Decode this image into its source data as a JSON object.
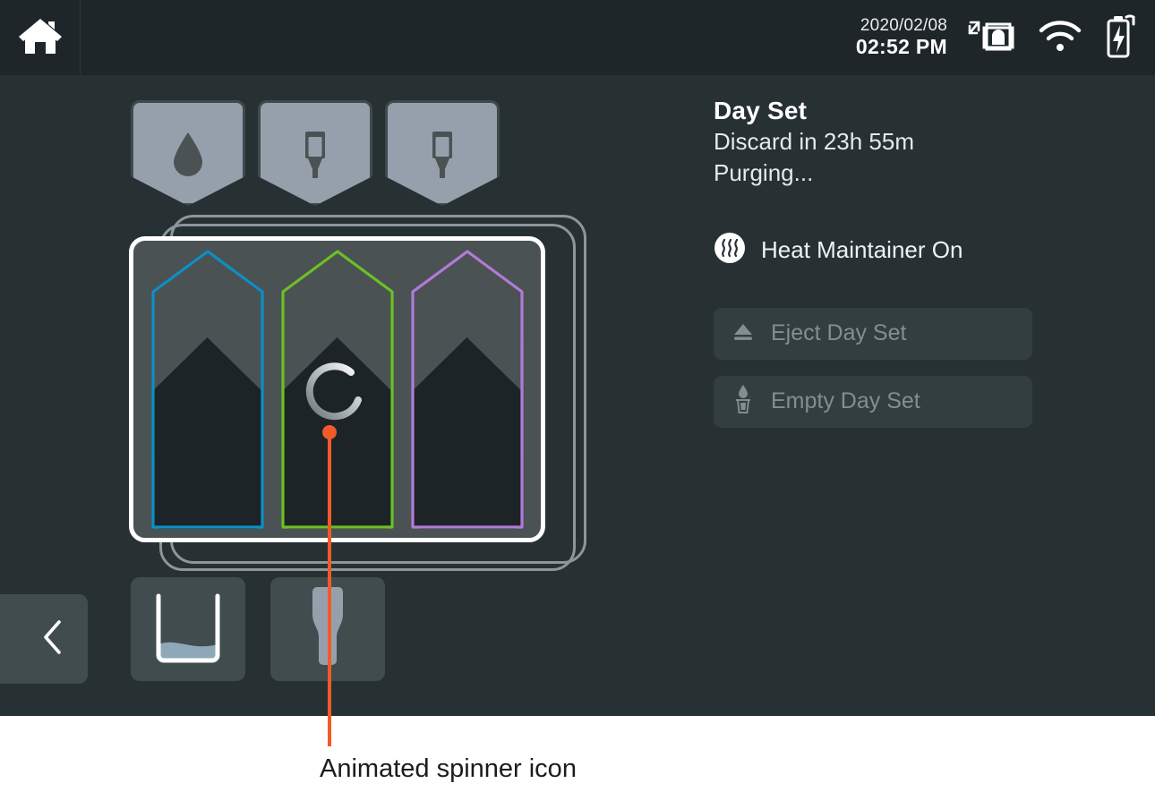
{
  "topbar": {
    "home_icon": "home-icon",
    "date": "2020/02/08",
    "time": "02:52 PM",
    "status_icons": [
      {
        "name": "transfer-printer-icon",
        "label": "Transfer"
      },
      {
        "name": "wifi-icon",
        "label": "Wi-Fi"
      },
      {
        "name": "battery-charging-icon",
        "label": "Battery charging"
      }
    ]
  },
  "nav": {
    "back_icon": "chevron-left-icon",
    "back_label": "Back"
  },
  "status_shields": [
    {
      "name": "shield-fluid",
      "icon": "droplet-icon"
    },
    {
      "name": "shield-vial-1",
      "icon": "vial-icon"
    },
    {
      "name": "shield-vial-2",
      "icon": "vial-icon"
    }
  ],
  "tray": {
    "name": "day-set-tray",
    "cassettes": [
      {
        "name": "cassette-blue",
        "color": "#0d8fc4",
        "busy": false
      },
      {
        "name": "cassette-green",
        "color": "#6cc023",
        "busy": true
      },
      {
        "name": "cassette-purple",
        "color": "#b37ad8",
        "busy": false
      }
    ],
    "spinner": {
      "name": "loading-spinner",
      "color": "#ffffff"
    }
  },
  "bottom_icons": [
    {
      "name": "waste-container-icon",
      "label": "Waste container"
    },
    {
      "name": "filter-cup-icon",
      "label": "Filter cup"
    }
  ],
  "panel": {
    "title": "Day Set",
    "discard": "Discard in 23h 55m",
    "state": "Purging...",
    "heat": {
      "icon": "heat-waves-icon",
      "label": "Heat Maintainer On"
    },
    "buttons": [
      {
        "name": "eject-day-set-button",
        "icon": "eject-icon",
        "label": "Eject Day Set",
        "enabled": false
      },
      {
        "name": "empty-day-set-button",
        "icon": "trash-drop-icon",
        "label": "Empty Day Set",
        "enabled": false
      }
    ]
  },
  "annotation": {
    "text": "Animated spinner icon",
    "color": "#f15a29"
  },
  "colors": {
    "background": "#273134",
    "topbar": "#1e2629",
    "tray_panel": "#4a5254",
    "cassette_fill": "#1c2427",
    "accent": "#f15a29"
  }
}
